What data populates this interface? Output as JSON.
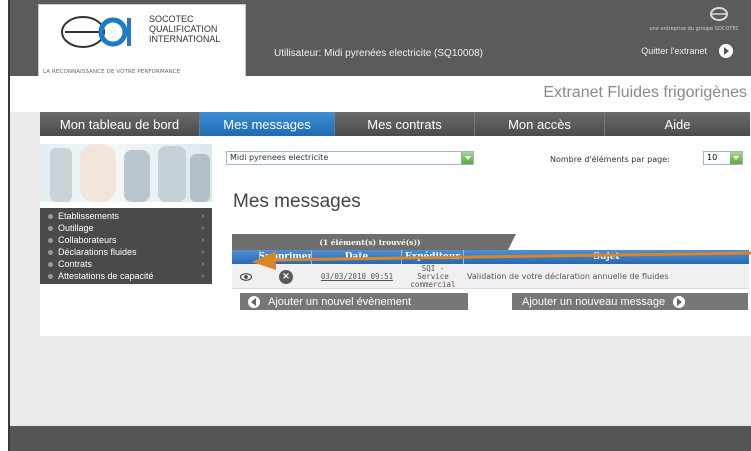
{
  "header": {
    "logo_line1": "SOCOTEC",
    "logo_line2": "QUALIFICATION",
    "logo_line3": "INTERNATIONAL",
    "logo_tagline": "LA RECONNAISSANCE DE VOTRE PERFORMANCE",
    "user_text": "Utilisateur: Midi pyrenées electricite (SQ10008)",
    "group_text": "une entreprise du groupe SOCOTEC",
    "quit_label": "Quitter l'extranet",
    "extranet_title": "Extranet Fluides frigorigènes"
  },
  "nav": {
    "items": [
      "Mon tableau de bord",
      "Mes messages",
      "Mes contrats",
      "Mon accès",
      "Aide"
    ],
    "active": "Mes messages"
  },
  "sidebar": {
    "items": [
      "Etablissements",
      "Outillage",
      "Collaborateurs",
      "Déclarations fluides",
      "Contrats",
      "Attestations de capacité"
    ]
  },
  "filters": {
    "company_value": "Midi pyrenees electricite",
    "perpage_label": "Nombre d'éléments par page:",
    "perpage_value": "10"
  },
  "main": {
    "heading": "Mes messages",
    "count_text": "(1 élément(s) trouvé(s))"
  },
  "table": {
    "columns": [
      "",
      "Supprimer",
      "Date",
      "Expéditeur",
      "Sujet"
    ],
    "rows": [
      {
        "date": "03/03/2010 09:51",
        "sender_line1": "SQI - Service",
        "sender_line2": "commercial",
        "subject": "Validation de votre déclaration annuelle de fluides"
      }
    ]
  },
  "buttons": {
    "add_event": "Ajouter un nouvel évènement",
    "add_message": "Ajouter un nouveau message"
  },
  "colors": {
    "nav_active": "#2f7cc6",
    "annotation_arrow": "#d9862a"
  }
}
